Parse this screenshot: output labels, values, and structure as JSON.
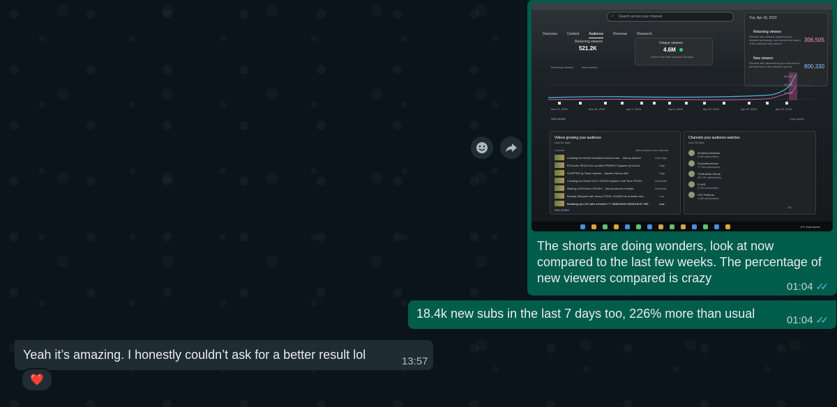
{
  "conversation": {
    "messages": [
      {
        "direction": "outgoing",
        "type": "image",
        "caption": "The shorts are doing wonders, look at now compared to the last few weeks. The percentage of new viewers compared is crazy",
        "time": "01:04",
        "status": "read"
      },
      {
        "direction": "outgoing",
        "type": "text",
        "text": "18.4k new subs in the last 7 days too, 226% more than usual",
        "time": "01:04",
        "status": "read"
      },
      {
        "direction": "incoming",
        "type": "text",
        "text": "Yeah it’s amazing. I honestly couldn’t ask for a better result lol",
        "time": "13:57",
        "reaction": "❤️"
      }
    ],
    "hover_actions": [
      "emoji-react",
      "forward"
    ]
  },
  "screenshot": {
    "search_placeholder": "Search across your channel",
    "tabs": [
      "Overview",
      "Content",
      "Audience",
      "Revenue",
      "Research"
    ],
    "active_tab": "Audience",
    "returning_viewers_label": "Returning viewers",
    "returning_viewers_value": "521.2K",
    "unique_viewers_label": "Unique viewers",
    "unique_viewers_value": "4.6M",
    "unique_viewers_note": "444% more than previous 28 days",
    "tooltip_date": "Tue, Apr 18, 2023",
    "tooltip_returning_label": "Returning viewers",
    "tooltip_returning_desc": "Viewers who already watched your channel previously, and returned to watch in the selected time period",
    "tooltip_returning_value": "306,505",
    "tooltip_new_label": "New viewers",
    "tooltip_new_desc": "Viewers who discovered your channel for the first time in the selected period",
    "tooltip_new_value": "800,330",
    "legend_returning": "Returning viewers",
    "legend_new": "New viewers",
    "y_ticks": [
      "600.0K",
      "400.0K",
      "200.0K",
      "0"
    ],
    "x_dates": [
      "Mar 19, 2023",
      "Mar 25, 2023",
      "Apr 1, 2023",
      "Apr 6, 2023",
      "Apr 10, 2023",
      "Apr 15, 2023",
      "Apr 19, 2023"
    ],
    "see_more": "SEE MORE",
    "chart_guide": "Chart guide",
    "panel_left_title": "Videos growing your audience",
    "panel_left_sub": "Last 90 days",
    "panel_left_col1": "Content",
    "panel_left_col2": "New viewers who returned",
    "videos": [
      {
        "title": "Creating the Worst Headstone Band Imam... #funny #anime",
        "level": "Very high"
      },
      {
        "title": "Elf Doctor REACH to my Mind PRIMPLE #games (ft Doctor",
        "level": "High"
      },
      {
        "title": "SLAPPED by Stack Update... #sports #funny #hill",
        "level": "High"
      },
      {
        "title": "Creating the Worst GOLF CRUSH injuries of all Time FROM...",
        "level": "Moderate"
      },
      {
        "title": "Making a Elf Doctor CRUSH... #funny #doctor #health",
        "level": "Moderate"
      },
      {
        "title": "Brutally Whipped with Heavy STEEL CHAINS as Animals ride...",
        "level": "Low"
      },
      {
        "title": "Breaking my LEG with a Kendo!! ?+ SAMURAIS DEADLIEST WE...",
        "level": "Low"
      }
    ],
    "panel_right_title": "Channels your audience watches",
    "panel_right_sub": "Last 28 days",
    "channels": [
      {
        "name": "Kimberly Dellolisa",
        "subs": "5.3M subscribers"
      },
      {
        "name": "Sonnellfrombeen",
        "subs": "77.3M subscribers"
      },
      {
        "name": "TheBoltLife Shorts",
        "subs": "301.9K subscribers"
      },
      {
        "name": "FLAIR",
        "subs": "5.7M subscribers"
      },
      {
        "name": "OST Reflects",
        "subs": "4.9M subscribers"
      }
    ],
    "pagination": "1/6",
    "taskbar_weather": "6°C  Kars sheen"
  },
  "colors": {
    "outgoing_bubble": "#005c4b",
    "incoming_bubble": "#202c33",
    "read_ticks": "#53bdeb",
    "chart_new_viewers": "#4fb7e6",
    "chart_returning": "#c85a9a"
  }
}
